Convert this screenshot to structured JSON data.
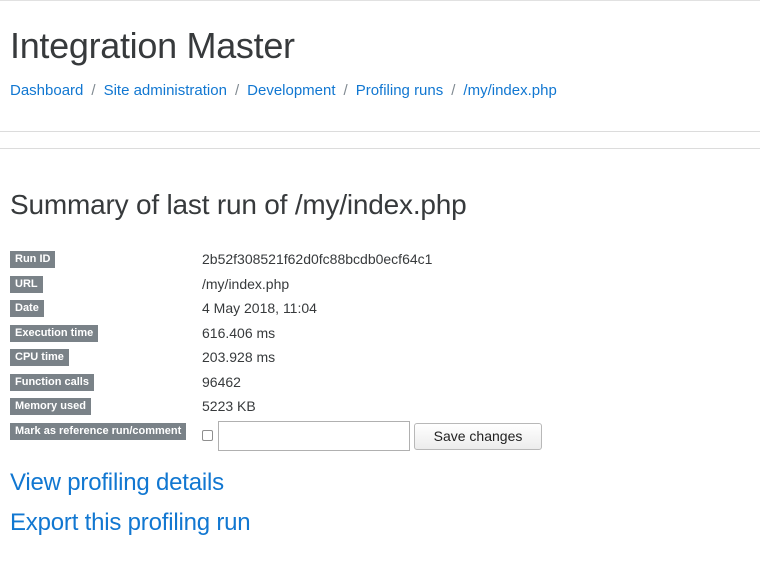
{
  "header": {
    "site_title": "Integration Master"
  },
  "breadcrumb": {
    "items": [
      {
        "label": "Dashboard"
      },
      {
        "label": "Site administration"
      },
      {
        "label": "Development"
      },
      {
        "label": "Profiling runs"
      },
      {
        "label": "/my/index.php"
      }
    ],
    "separator": "/"
  },
  "summary": {
    "heading": "Summary of last run of /my/index.php",
    "rows": [
      {
        "label": "Run ID",
        "value": "2b52f308521f62d0fc88bcdb0ecf64c1"
      },
      {
        "label": "URL",
        "value": "/my/index.php"
      },
      {
        "label": "Date",
        "value": "4 May 2018, 11:04"
      },
      {
        "label": "Execution time",
        "value": "616.406 ms"
      },
      {
        "label": "CPU time",
        "value": "203.928 ms"
      },
      {
        "label": "Function calls",
        "value": "96462"
      },
      {
        "label": "Memory used",
        "value": "5223 KB"
      }
    ],
    "reference": {
      "label": "Mark as reference run/comment",
      "checked": false,
      "comment_value": "",
      "save_label": "Save changes"
    }
  },
  "links": {
    "view_details": "View profiling details",
    "export_run": "Export this profiling run"
  },
  "colors": {
    "link": "#1177d1",
    "label_badge_bg": "#7a8288",
    "text": "#373a3c"
  }
}
